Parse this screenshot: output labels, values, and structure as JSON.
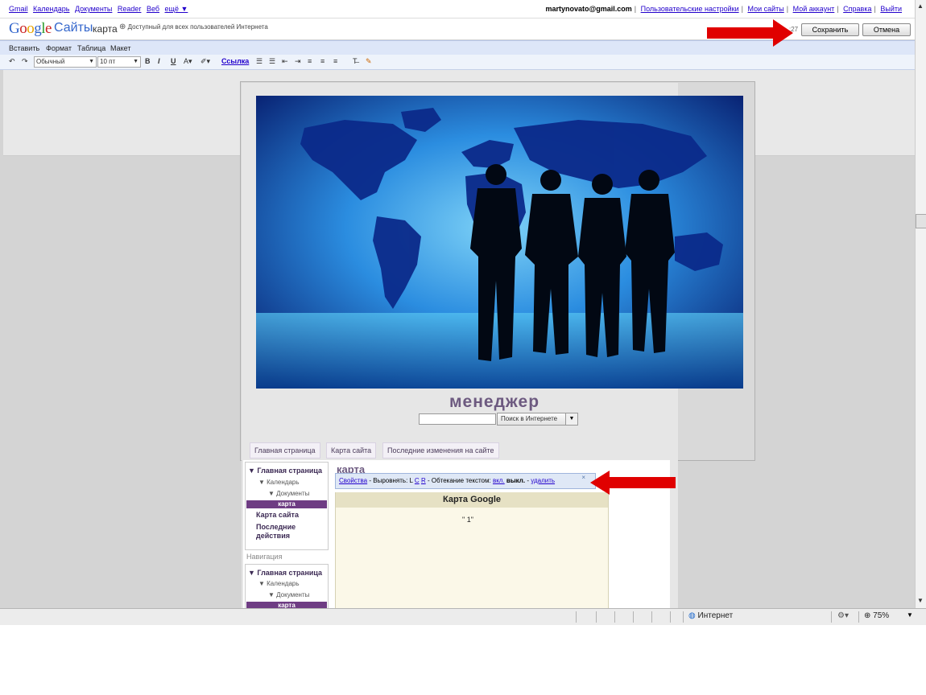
{
  "topbar": {
    "links": [
      "Gmail",
      "Календарь",
      "Документы",
      "Reader",
      "Веб",
      "ещё ▼"
    ],
    "email": "martynovato@gmail.com",
    "account_links": [
      "Пользовательские настройки",
      "Мои сайты",
      "Мой аккаунт",
      "Справка",
      "Выйти"
    ]
  },
  "header": {
    "logo": "Google",
    "product": "Сайты",
    "page_name": "карта",
    "public_note": "Доступный для всех пользователей Интернета",
    "time": ":27",
    "save_label": "Сохранить",
    "cancel_label": "Отмена"
  },
  "menubar": [
    "Вставить",
    "Формат",
    "Таблица",
    "Макет"
  ],
  "toolbar": {
    "style_select": "Обычный",
    "size_select": "10 пт",
    "bold": "B",
    "italic": "I",
    "underline": "U",
    "font_color": "A▾",
    "highlight": "✐▾",
    "link_label": "Ссылка",
    "clear_format": "T̶"
  },
  "site": {
    "name": "менеджер",
    "search_button": "Поиск в Интернете",
    "tabs": [
      "Главная страница",
      "Карта сайта",
      "Последние изменения на сайте"
    ],
    "sidebar": {
      "home": "Главная страница",
      "calendar": "Календарь",
      "documents": "Документы",
      "active": "карта",
      "sitemap": "Карта сайта",
      "recent": "Последние действия",
      "nav_heading": "Навигация"
    },
    "page_heading": "карта"
  },
  "propsbar": {
    "properties": "Свойства",
    "align_label": "- Выровнять: L",
    "align_c": "C",
    "align_r": "R",
    "wrap_label": "- Обтекание текстом:",
    "wrap_on": "вкл.",
    "wrap_off": "выкл.",
    "dash": "-",
    "delete": "удалить",
    "close": "×"
  },
  "map_widget": {
    "title": "Карта Google",
    "value": "\"  1\""
  },
  "statusbar": {
    "zone": "Интернет",
    "zoom": "75%"
  },
  "colors": {
    "link": "#2200cc",
    "site_accent": "#6d5a80",
    "active_nav": "#6e3c83",
    "arrow": "#e00000"
  }
}
